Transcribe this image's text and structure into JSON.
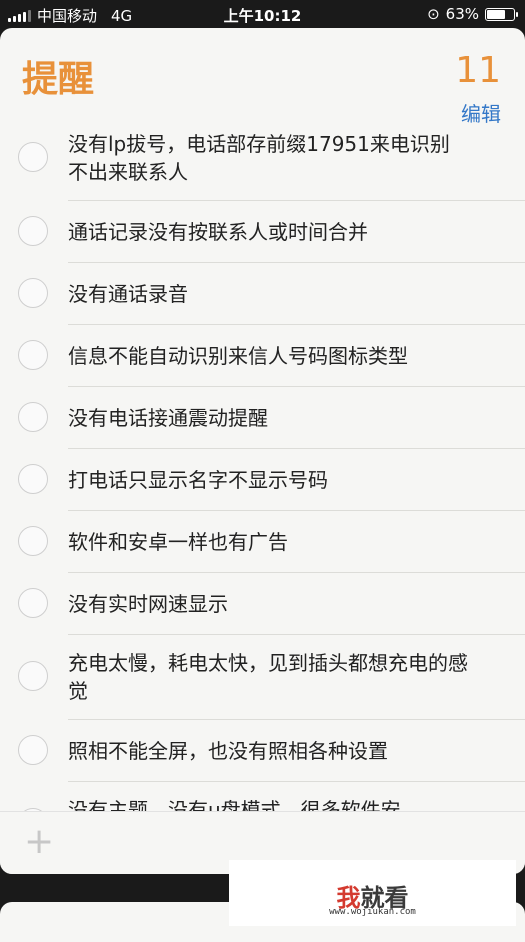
{
  "status_bar": {
    "carrier": "中国移动",
    "network": "4G",
    "time": "上午10:12",
    "battery_text": "63%",
    "battery_level": 0.63
  },
  "header": {
    "title": "提醒",
    "count": "11",
    "edit_label": "编辑"
  },
  "reminders": [
    "没有lp拔号，电话部存前缀17951来电识别不出来联系人",
    "通话记录没有按联系人或时间合并",
    "没有通话录音",
    "信息不能自动识别来信人号码图标类型",
    "没有电话接通震动提醒",
    "打电话只显示名字不显示号码",
    "软件和安卓一样也有广告",
    "没有实时网速显示",
    "充电太慢，耗电太快，见到插头都想充电的感觉",
    "照相不能全屏，也没有照相各种设置",
    "没有主题，没有u盘模式，很多软件安"
  ],
  "footer": {
    "add_symbol": "+"
  },
  "watermark": {
    "brand_mark": "我",
    "brand_rest": "就看",
    "url": "www.wojiukan.com"
  }
}
